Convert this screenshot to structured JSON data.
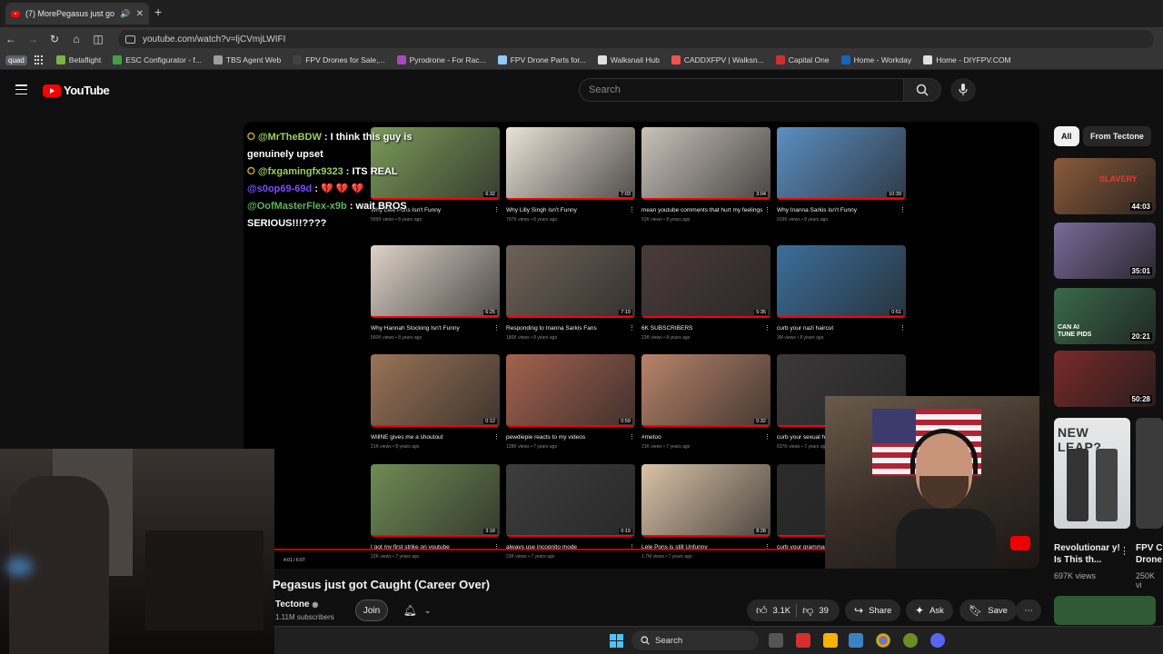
{
  "browser": {
    "tab_title": "(7) MorePegasus just got C",
    "url": "youtube.com/watch?v=ljCVmjLWIFI",
    "bookmarks": [
      {
        "label": "Betaflight",
        "color": "#7cb342"
      },
      {
        "label": "ESC Configurator - f...",
        "color": "#43a047"
      },
      {
        "label": "TBS Agent Web",
        "color": "#9e9e9e"
      },
      {
        "label": "FPV Drones for Sale,...",
        "color": "#424242"
      },
      {
        "label": "Pyrodrone - For Rac...",
        "color": "#ab47bc"
      },
      {
        "label": "FPV Drone Parts for...",
        "color": "#90caf9"
      },
      {
        "label": "Walksnail Hub",
        "color": "#e0e0e0"
      },
      {
        "label": "CADDXFPV | Walksn...",
        "color": "#ef5350"
      },
      {
        "label": "Capital One",
        "color": "#d32f2f"
      },
      {
        "label": "Home - Workday",
        "color": "#1565c0"
      },
      {
        "label": "Home - DIYFPV.COM",
        "color": "#e0e0e0"
      }
    ],
    "quad_label": "quad"
  },
  "youtube": {
    "logo_text": "YouTube",
    "search_placeholder": "Search"
  },
  "chat": [
    {
      "user": "@MrTheBDW",
      "text": " : I think this guy is genuinely upset",
      "icon": "⭘"
    },
    {
      "user": "@fxgamingfx9323",
      "text": " : ITS REAL",
      "icon": "⭘"
    },
    {
      "user": "@s0op69-69d",
      "text": " : ",
      "hearts": "💔 💔 💔"
    },
    {
      "user": "@OofMasterFlex-x9b",
      "text": " : wait BROS SERIOUS!!!????"
    }
  ],
  "grid_videos": [
    {
      "title": "Why Lele Pons Isn't Funny",
      "meta": "555K views • 8 years ago",
      "dur": "6:32",
      "bg": "#7b9a5a"
    },
    {
      "title": "Why Lilly Singh Isn't Funny",
      "meta": "797K views • 8 years ago",
      "dur": "7:03",
      "bg": "#e9e2d6"
    },
    {
      "title": "mean youtube comments that hurt my feelings",
      "meta": "52K views • 8 years ago",
      "dur": "3:04",
      "bg": "#c9c2b9"
    },
    {
      "title": "Why Inanna Sarkis Isn't Funny",
      "meta": "919K views • 8 years ago",
      "dur": "10:39",
      "bg": "#5b8fc2"
    },
    {
      "title": "Why Hannah Stocking Isn't Funny",
      "meta": "560K views • 8 years ago",
      "dur": "6:25",
      "bg": "#ddd2c7"
    },
    {
      "title": "Responding to Inanna Sarkis Fans",
      "meta": "180K views • 8 years ago",
      "dur": "7:19",
      "bg": "#6e6257"
    },
    {
      "title": "6K SUBSCRIBERS",
      "meta": "23K views • 8 years ago",
      "dur": "5:35",
      "bg": "#4a3b3a"
    },
    {
      "title": "curb your nazi haircut",
      "meta": "3M views • 8 years ago",
      "dur": "0:51",
      "bg": "#3b6e9a"
    },
    {
      "title": "WillNE gives me a shoutout",
      "meta": "21K views • 8 years ago",
      "dur": "0:12",
      "bg": "#9a7357"
    },
    {
      "title": "pewdiepie reacts to my videos",
      "meta": "128K views • 7 years ago",
      "dur": "0:59",
      "bg": "#a4624f"
    },
    {
      "title": "#metoo",
      "meta": "21K views • 7 years ago",
      "dur": "0:32",
      "bg": "#b8836a"
    },
    {
      "title": "curb your sexual h",
      "meta": "637K views • 7 years ago",
      "dur": "",
      "bg": "#3a3838"
    },
    {
      "title": "I got my first strike on youtube",
      "meta": "22K views • 7 years ago",
      "dur": "3:18",
      "bg": "#6f8c55"
    },
    {
      "title": "always use incognito mode",
      "meta": "23K views • 7 years ago",
      "dur": "0:19",
      "bg": "#3d3d3d"
    },
    {
      "title": "Lele Pons is still Unfunny",
      "meta": "1.7M views • 7 years ago",
      "dur": "8:28",
      "bg": "#d9c2a7"
    },
    {
      "title": "curb your gramma",
      "meta": "",
      "dur": "",
      "bg": "#2b2b2b"
    }
  ],
  "player": {
    "time": "4:01 / 6:07",
    "progress": 1.0
  },
  "video": {
    "title": "Pegasus just got Caught (Career Over)",
    "channel": "Tectone",
    "subscribers": "1.11M subscribers",
    "join_label": "Join",
    "likes": "3.1K",
    "dislikes": "39",
    "share_label": "Share",
    "ask_label": "Ask",
    "save_label": "Save"
  },
  "sidebar": {
    "chips": [
      "All",
      "From Tectone"
    ],
    "videos": [
      {
        "dur": "44:03",
        "bg": "#8a5a3a",
        "label": "SLAVERY"
      },
      {
        "dur": "35:01",
        "bg": "#7a6a9a",
        "label": ""
      },
      {
        "dur": "20:21",
        "bg": "#3a6a4a",
        "label": "CAN AI TUNE PIDS"
      },
      {
        "dur": "50:28",
        "bg": "#7a2a2a",
        "label": ""
      }
    ],
    "featured_title": "Revolutionar y! Is This th...",
    "featured_views": "697K views",
    "featured_title2": "FPV C Drone",
    "featured_views2": "250K vi",
    "featured_thumb_text": "NEW LEAP?"
  },
  "taskbar": {
    "search_label": "Search"
  }
}
